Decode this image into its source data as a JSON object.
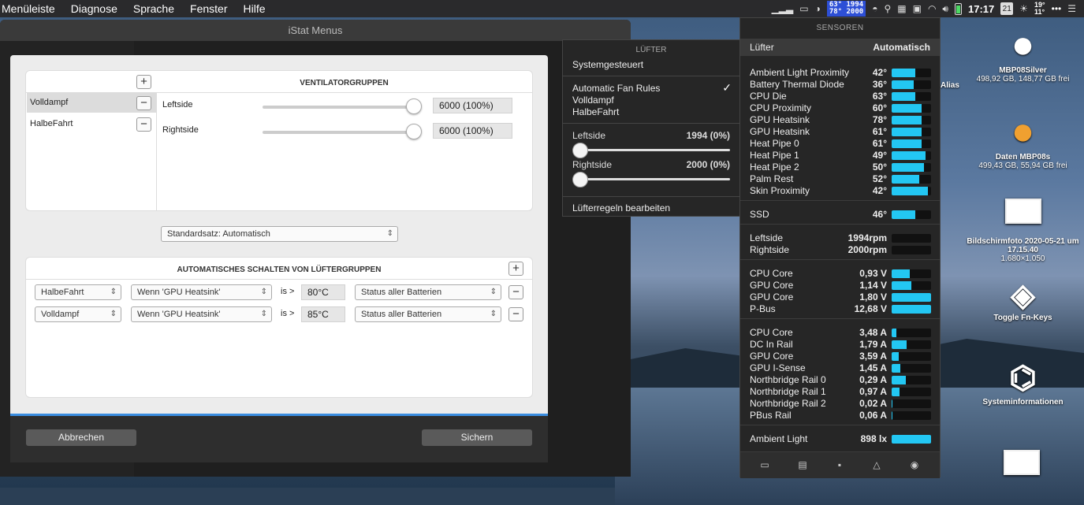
{
  "menubar": {
    "items": [
      "Menüleiste",
      "Diagnose",
      "Sprache",
      "Fenster",
      "Hilfe"
    ],
    "fan_badge_line1": "63° 1994",
    "fan_badge_line2": "78° 2000",
    "clock": "17:17",
    "calendar_day": "21",
    "weather_high": "19°",
    "weather_low": "11°",
    "more": "•••"
  },
  "back_window": {
    "title": "iStat Menus"
  },
  "fan_groups": {
    "title": "VENTILATORGRUPPEN",
    "groups": [
      "Volldampf",
      "HalbeFahrt"
    ],
    "sliders": [
      {
        "label": "Leftside",
        "value": "6000 (100%)",
        "fraction": 1.0
      },
      {
        "label": "Rightside",
        "value": "6000 (100%)",
        "fraction": 1.0
      }
    ]
  },
  "preset_select": "Standardsatz: Automatisch",
  "auto_switch": {
    "title": "AUTOMATISCHES SCHALTEN VON LÜFTERGRUPPEN",
    "rules": [
      {
        "group": "HalbeFahrt",
        "condition": "Wenn 'GPU Heatsink'",
        "op": "is >",
        "value": "80°C",
        "power": "Status aller Batterien"
      },
      {
        "group": "Volldampf",
        "condition": "Wenn 'GPU Heatsink'",
        "op": "is >",
        "value": "85°C",
        "power": "Status aller Batterien"
      }
    ]
  },
  "sheet_buttons": {
    "cancel": "Abbrechen",
    "save": "Sichern"
  },
  "fan_menu": {
    "header": "LÜFTER",
    "system": "Systemgesteuert",
    "options": [
      "Automatic Fan Rules",
      "Volldampf",
      "HalbeFahrt"
    ],
    "checkmark": "✓",
    "sliders": [
      {
        "label": "Leftside",
        "value": "1994 (0%)",
        "fraction": 0.0
      },
      {
        "label": "Rightside",
        "value": "2000 (0%)",
        "fraction": 0.0
      }
    ],
    "edit": "Lüfterregeln bearbeiten"
  },
  "sensors": {
    "header": "SENSOREN",
    "fan_label": "Lüfter",
    "fan_mode": "Automatisch",
    "temps": [
      {
        "name": "Ambient Light Proximity",
        "value": "42°",
        "level": 0.6
      },
      {
        "name": "Battery Thermal Diode",
        "value": "36°",
        "level": 0.55
      },
      {
        "name": "CPU Die",
        "value": "63°",
        "level": 0.6
      },
      {
        "name": "CPU Proximity",
        "value": "60°",
        "level": 0.75
      },
      {
        "name": "GPU Heatsink",
        "value": "78°",
        "level": 0.75
      },
      {
        "name": "GPU Heatsink",
        "value": "61°",
        "level": 0.75
      },
      {
        "name": "Heat Pipe 0",
        "value": "61°",
        "level": 0.75
      },
      {
        "name": "Heat Pipe 1",
        "value": "49°",
        "level": 0.85
      },
      {
        "name": "Heat Pipe 2",
        "value": "50°",
        "level": 0.82
      },
      {
        "name": "Palm Rest",
        "value": "52°",
        "level": 0.7
      },
      {
        "name": "Skin Proximity",
        "value": "42°",
        "level": 0.92
      }
    ],
    "ssd": {
      "name": "SSD",
      "value": "46°",
      "level": 0.6
    },
    "fans": [
      {
        "name": "Leftside",
        "value": "1994rpm",
        "level": 0.0
      },
      {
        "name": "Rightside",
        "value": "2000rpm",
        "level": 0.0
      }
    ],
    "voltages": [
      {
        "name": "CPU Core",
        "value": "0,93 V",
        "level": 0.45
      },
      {
        "name": "GPU Core",
        "value": "1,14 V",
        "level": 0.5
      },
      {
        "name": "GPU Core",
        "value": "1,80 V",
        "level": 1.0
      },
      {
        "name": "P-Bus",
        "value": "12,68 V",
        "level": 1.0
      }
    ],
    "currents": [
      {
        "name": "CPU Core",
        "value": "3,48 A",
        "level": 0.12
      },
      {
        "name": "DC In Rail",
        "value": "1,79 A",
        "level": 0.38
      },
      {
        "name": "GPU Core",
        "value": "3,59 A",
        "level": 0.18
      },
      {
        "name": "GPU I-Sense",
        "value": "1,45 A",
        "level": 0.22
      },
      {
        "name": "Northbridge Rail 0",
        "value": "0,29 A",
        "level": 0.35
      },
      {
        "name": "Northbridge Rail 1",
        "value": "0,97 A",
        "level": 0.2
      },
      {
        "name": "Northbridge Rail 2",
        "value": "0,02 A",
        "level": 0.02
      },
      {
        "name": "PBus Rail",
        "value": "0,06 A",
        "level": 0.02
      }
    ],
    "ambient": {
      "name": "Ambient Light",
      "value": "898 lx",
      "level": 1.0
    }
  },
  "desktop": {
    "disk1": {
      "name": "MBP08Silver",
      "info": "498,92 GB, 148,77 GB frei"
    },
    "disk2": {
      "name": "Daten MBP08s",
      "info": "499,43 GB, 55,94 GB frei"
    },
    "alias": "Alias",
    "screenshot": {
      "name": "Bildschirmfoto 2020-05-21 um 17.15.40",
      "size": "1.680×1.050"
    },
    "toggle": "Toggle Fn-Keys",
    "sysinfo": "Systeminformationen"
  }
}
